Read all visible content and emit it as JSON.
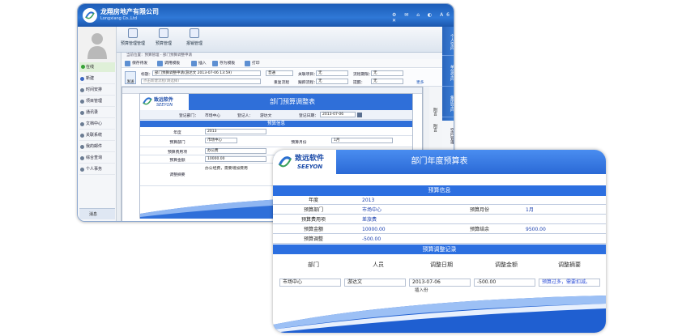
{
  "app": {
    "company_cn": "龙翔房地产有限公司",
    "company_en": "Longxiang Co.,Ltd",
    "window_icons": "⚙ ✉ ⌂ ◐ A6 ✕"
  },
  "top_tabs": [
    {
      "label": "预算管理管理"
    },
    {
      "label": "预算管理"
    },
    {
      "label": "报销管理"
    }
  ],
  "sidebar": {
    "online": "在线",
    "items": [
      {
        "label": "新建"
      },
      {
        "label": "时间安排"
      },
      {
        "label": "项目管理"
      },
      {
        "label": "通讯录"
      },
      {
        "label": "文档中心"
      },
      {
        "label": "关联系统"
      },
      {
        "label": "我的邮件"
      },
      {
        "label": "综合查询"
      },
      {
        "label": "个人事务"
      }
    ],
    "messages": "消息"
  },
  "back": {
    "breadcrumb": "当前位置：预算管理 - 部门预算调整申请",
    "toolbar": [
      "保存待发",
      "调用模板",
      "插入",
      "存为模板",
      "打印"
    ],
    "send": "发送",
    "title_label": "标题：",
    "title_value": "部门预算调整申请(游达文 2013-07-06 13:59)",
    "flow_placeholder": "点击新建流程(请选择)",
    "importance_label": "普通",
    "related_label": "关联项目：",
    "related_value": "无",
    "period_label": "流程期限：",
    "period_value": "无",
    "deadline_label": "跟踪流程：",
    "deadline_value": "无",
    "remind_label": "提醒：",
    "remind_value": "无",
    "flow_btn": "重复流程",
    "more": "更多",
    "right_tabs": [
      "个人空间",
      "单位空间",
      "集团空间",
      "空间管理"
    ],
    "side_labels": [
      "附言",
      "附言"
    ]
  },
  "doc_small": {
    "logo_cn": "致远软件",
    "logo_en": "SEEYON",
    "title": "部门预算调整表",
    "dept_label": "登记部门：",
    "dept_value": "市场中心",
    "person_label": "登记人：",
    "person_value": "游达文",
    "date_label": "登记日期：",
    "date_value": "2013-07-06",
    "section": "预算信息",
    "rows": [
      {
        "label": "年度",
        "value": "2013"
      },
      {
        "label": "预算部门",
        "value": "市场中心",
        "label2": "预算月份",
        "value2": "1月"
      },
      {
        "label": "预算费用项",
        "value": "办公费"
      },
      {
        "label": "预算金额",
        "value": "10000.00"
      },
      {
        "label": "调整摘要",
        "value": "办公经费，需要增加费用"
      }
    ]
  },
  "front": {
    "logo_cn": "致远软件",
    "logo_en": "SEEYON",
    "title": "部门年度预算表",
    "section1": "预算信息",
    "rows": [
      {
        "label": "年度",
        "value": "2013",
        "label2": "",
        "value2": ""
      },
      {
        "label": "预算部门",
        "value": "市场中心",
        "label2": "预算月份",
        "value2": "1月"
      },
      {
        "label": "预算费用项",
        "value": "差旅费",
        "label2": "",
        "value2": ""
      },
      {
        "label": "预算金额",
        "value": "10000.00",
        "label2": "预算结余",
        "value2": "9500.00"
      },
      {
        "label": "预算调整",
        "value": "-500.00",
        "label2": "",
        "value2": ""
      }
    ],
    "section2": "预算调整记录",
    "columns": [
      "部门",
      "人员",
      "调整日期",
      "调整金额",
      "调整摘要"
    ],
    "record": {
      "dept": "市场中心",
      "person": "游达文",
      "date": "2013-07-06",
      "amount": "-500.00",
      "summary": "预算过多，需要扣减。"
    },
    "append": "插入份"
  },
  "colors": {
    "brand_blue": "#2c6fe0",
    "title_bar": "#1d5db8",
    "value_blue": "#1a3fae",
    "summary_blue": "#2a4bd7"
  }
}
